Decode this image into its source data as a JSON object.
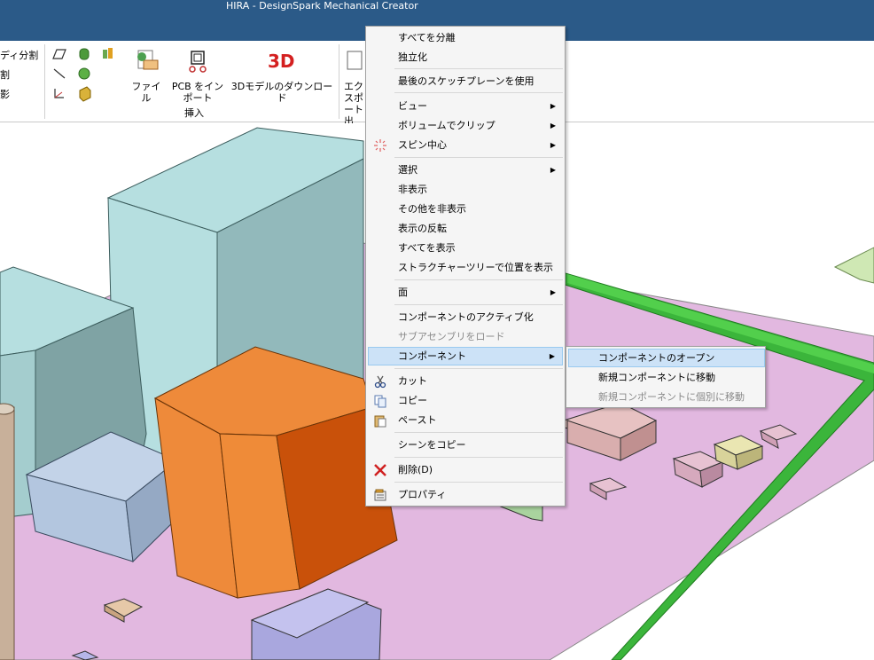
{
  "window": {
    "title": "HIRA - DesignSpark Mechanical Creator"
  },
  "ribbon": {
    "left_items": [
      "ディ分割",
      "割",
      "影"
    ],
    "buttons": {
      "file": "ファイル",
      "pcb_import": "PCB をインポート",
      "download_3d": "3Dモデルのダウンロード",
      "export": "エクスポート出"
    },
    "group_label": "挿入"
  },
  "context_menu": {
    "items": [
      {
        "label": "すべてを分離"
      },
      {
        "label": "独立化"
      },
      {
        "label": "最後のスケッチプレーンを使用"
      },
      {
        "label": "ビュー"
      },
      {
        "label": "ボリュームでクリップ"
      },
      {
        "label": "スピン中心"
      },
      {
        "label": "選択"
      },
      {
        "label": "非表示"
      },
      {
        "label": "その他を非表示"
      },
      {
        "label": "表示の反転"
      },
      {
        "label": "すべてを表示"
      },
      {
        "label": "ストラクチャーツリーで位置を表示"
      },
      {
        "label": "面"
      },
      {
        "label": "コンポーネントのアクティブ化"
      },
      {
        "label": "サブアセンブリをロード"
      },
      {
        "label": "コンポーネント"
      },
      {
        "label": "カット"
      },
      {
        "label": "コピー"
      },
      {
        "label": "ペースト"
      },
      {
        "label": "シーンをコピー"
      },
      {
        "label": "削除(D)"
      },
      {
        "label": "プロパティ"
      }
    ]
  },
  "submenu": {
    "items": [
      {
        "label": "コンポーネントのオープン"
      },
      {
        "label": "新規コンポーネントに移動"
      },
      {
        "label": "新規コンポーネントに個別に移動"
      }
    ]
  },
  "colors": {
    "titlebar": "#2b5a88",
    "board": "#e2b8e0",
    "board_edge": "#3bb53b",
    "orange_block": "#ee8a3a",
    "cyan_block": "#b6dfe0",
    "highlight": "#cce2f7"
  }
}
